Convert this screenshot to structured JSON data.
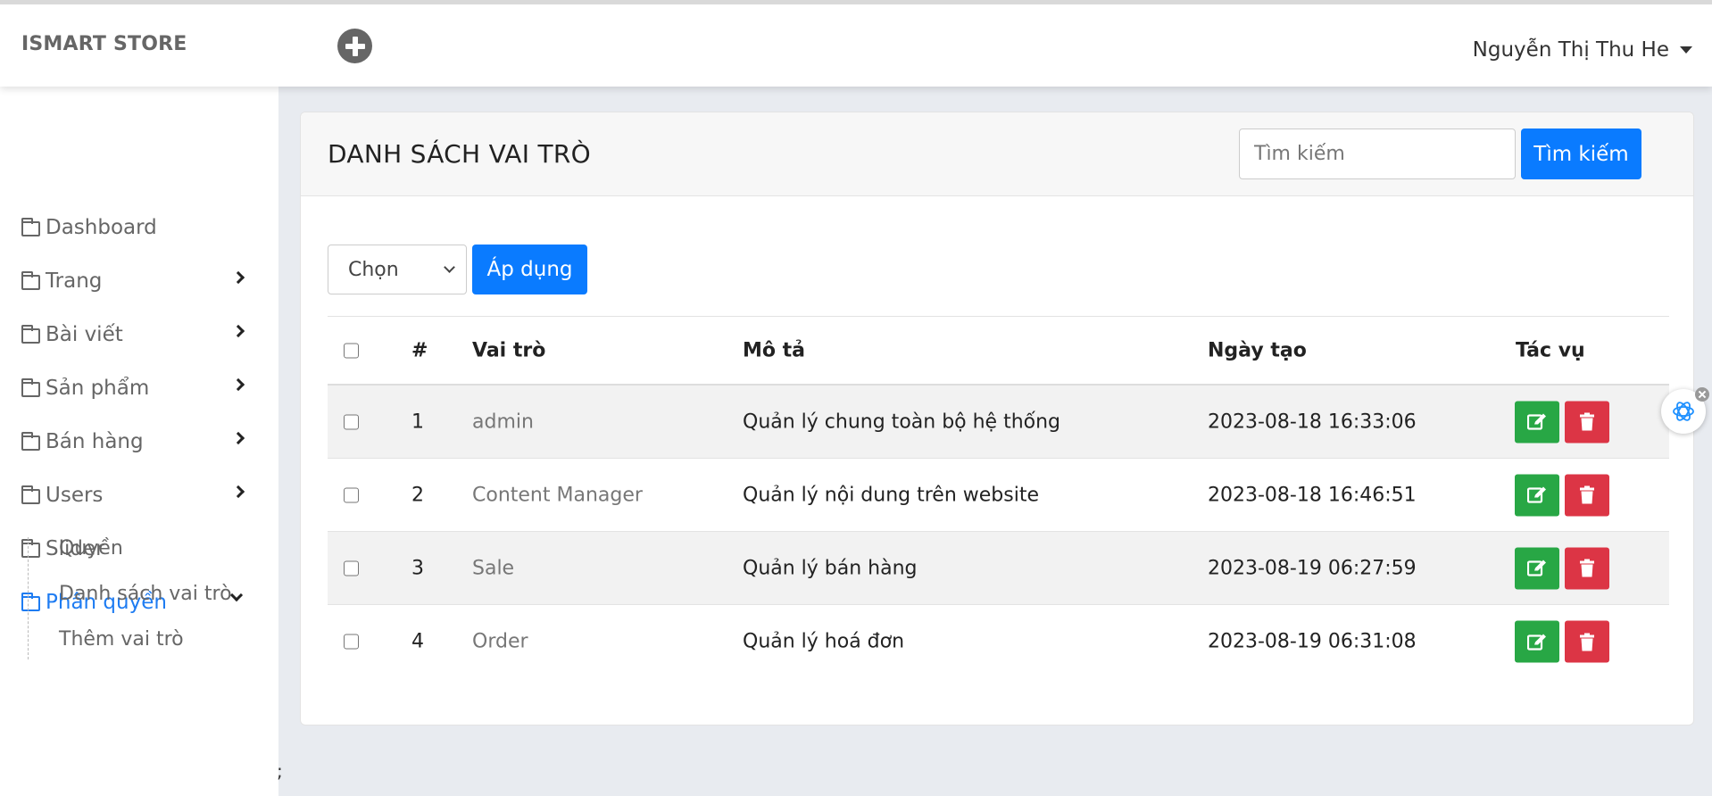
{
  "topbar": {
    "brand": "ISMART STORE",
    "add_icon": "plus-circle-icon",
    "user_name": "Nguyễn Thị Thu He"
  },
  "sidebar": {
    "items": [
      {
        "label": "Dashboard",
        "icon": "folder-icon",
        "has_children": false
      },
      {
        "label": "Trang",
        "icon": "folder-icon",
        "has_children": true
      },
      {
        "label": "Bài viết",
        "icon": "folder-icon",
        "has_children": true
      },
      {
        "label": "Sản phẩm",
        "icon": "folder-icon",
        "has_children": true
      },
      {
        "label": "Bán hàng",
        "icon": "folder-icon",
        "has_children": true
      },
      {
        "label": "Users",
        "icon": "folder-icon",
        "has_children": true
      },
      {
        "label": "Slider",
        "icon": "folder-icon",
        "has_children": false
      },
      {
        "label": "Phân quyền",
        "icon": "folder-icon",
        "has_children": true,
        "expanded": true
      }
    ],
    "subitems": [
      "Quyền",
      "Danh sách vai trò",
      "Thêm vai trò"
    ],
    "active_color": "#1e7cf2"
  },
  "main": {
    "title": "DANH SÁCH VAI TRÒ",
    "search_placeholder": "Tìm kiếm",
    "search_button": "Tìm kiếm",
    "bulk_action_selected": "Chọn",
    "apply_button": "Áp dụng",
    "table": {
      "headers": {
        "num": "#",
        "role": "Vai trò",
        "desc": "Mô tả",
        "date": "Ngày tạo",
        "actions": "Tác vụ"
      },
      "rows": [
        {
          "num": "1",
          "role": "admin",
          "desc": "Quản lý chung toàn bộ hệ thống",
          "date": "2023-08-18 16:33:06"
        },
        {
          "num": "2",
          "role": "Content Manager",
          "desc": "Quản lý nội dung trên website",
          "date": "2023-08-18 16:46:51"
        },
        {
          "num": "3",
          "role": "Sale",
          "desc": "Quản lý bán hàng",
          "date": "2023-08-19 06:27:59"
        },
        {
          "num": "4",
          "role": "Order",
          "desc": "Quản lý hoá đơn",
          "date": "2023-08-19 06:31:08"
        }
      ]
    },
    "primary_color": "#0a7bff",
    "edit_color": "#28a745",
    "delete_color": "#dc3545"
  },
  "footer_stray": ";"
}
